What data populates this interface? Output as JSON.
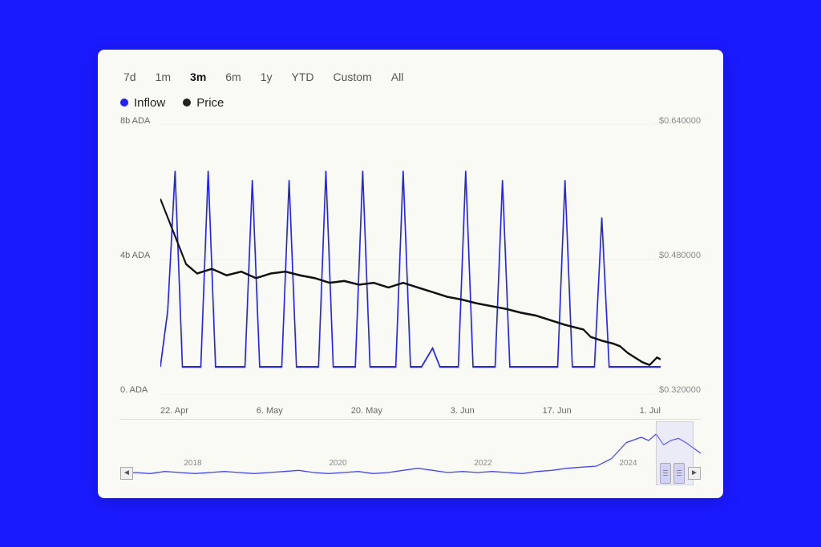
{
  "page": {
    "background": "#1a1aff",
    "card_bg": "#fafaf5"
  },
  "time_filters": {
    "items": [
      {
        "label": "7d",
        "active": false
      },
      {
        "label": "1m",
        "active": false
      },
      {
        "label": "3m",
        "active": true
      },
      {
        "label": "6m",
        "active": false
      },
      {
        "label": "1y",
        "active": false
      },
      {
        "label": "YTD",
        "active": false
      },
      {
        "label": "Custom",
        "active": false
      },
      {
        "label": "All",
        "active": false
      }
    ]
  },
  "legend": {
    "inflow_label": "Inflow",
    "price_label": "Price"
  },
  "y_axis_left": {
    "top": "8b ADA",
    "mid": "4b ADA",
    "bottom": "0. ADA"
  },
  "y_axis_right": {
    "top": "$0.640000",
    "mid": "$0.480000",
    "bottom": "$0.320000"
  },
  "x_axis": {
    "labels": [
      "22. Apr",
      "6. May",
      "20. May",
      "3. Jun",
      "17. Jun",
      "1. Jul"
    ]
  },
  "mini_chart": {
    "year_labels": [
      "2018",
      "2020",
      "2022",
      "2024"
    ]
  },
  "nav": {
    "left_arrow": "◄",
    "right_arrow": "►"
  }
}
